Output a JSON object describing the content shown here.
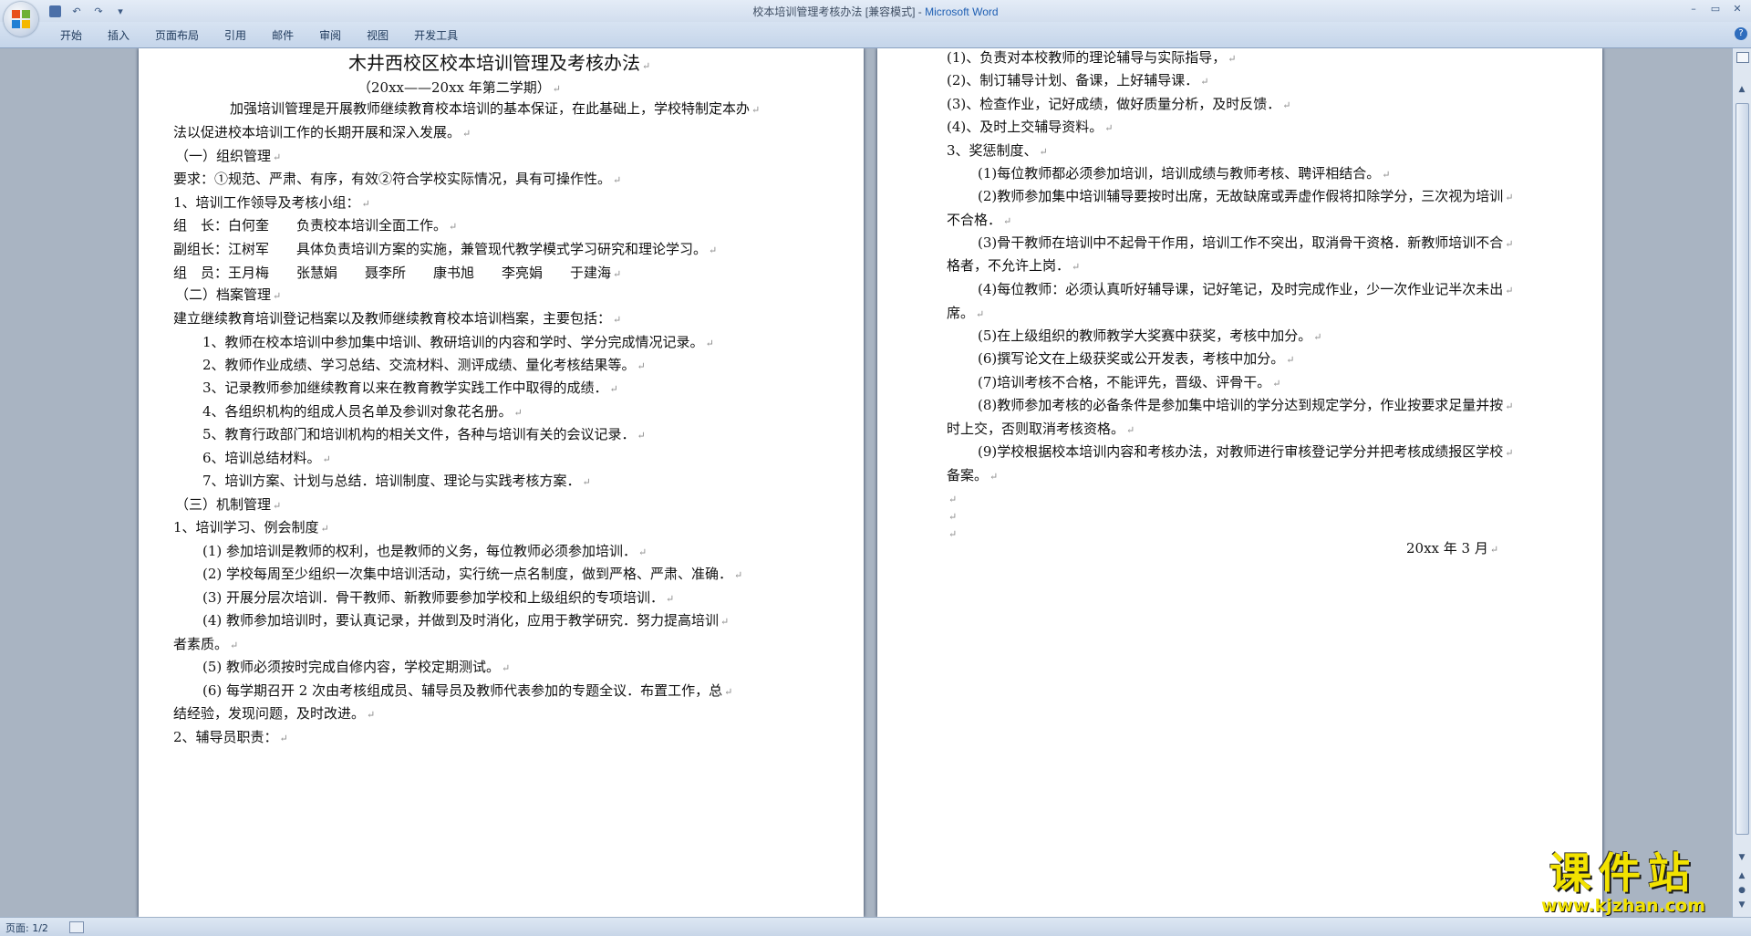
{
  "window": {
    "title": "校本培训管理考核办法 [兼容模式] - ",
    "app_name": "Microsoft Word",
    "controls": [
      "–",
      "▭",
      "✕"
    ]
  },
  "ribbon": {
    "tabs": [
      "开始",
      "插入",
      "页面布局",
      "引用",
      "邮件",
      "审阅",
      "视图",
      "开发工具"
    ],
    "help": "?"
  },
  "document": {
    "page1": [
      "木井西校区校本培训管理及考核办法",
      "（20xx——20xx 年第二学期）",
      "加强培训管理是开展教师继续教育校本培训的基本保证，在此基础上，学校特制定本办",
      "法以促进校本培训工作的长期开展和深入发展。",
      "（一）组织管理",
      "要求：①规范、严肃、有序，有效②符合学校实际情况，具有可操作性。",
      "1、培训工作领导及考核小组：",
      "组　长：白何奎　　负责校本培训全面工作。",
      "副组长：江树军　　具体负责培训方案的实施，兼管现代教学模式学习研究和理论学习。",
      "组　员：王月梅　　张慧娟　　聂李所　　康书旭　　李亮娟　　于建海",
      "（二）档案管理",
      "建立继续教育培训登记档案以及教师继续教育校本培训档案，主要包括：",
      "1、教师在校本培训中参加集中培训、教研培训的内容和学时、学分完成情况记录。",
      "2、教师作业成绩、学习总结、交流材料、测评成绩、量化考核结果等。",
      "3、记录教师参加继续教育以来在教育教学实践工作中取得的成绩．",
      "4、各组织机构的组成人员名单及参训对象花名册。",
      "5、教育行政部门和培训机构的相关文件，各种与培训有关的会议记录．",
      "6、培训总结材料。",
      "7、培训方案、计划与总结．培训制度、理论与实践考核方案．",
      "（三）机制管理",
      "1、培训学习、例会制度",
      "(1) 参加培训是教师的权利，也是教师的义务，每位教师必须参加培训．",
      "(2) 学校每周至少组织一次集中培训活动，实行统一点名制度，做到严格、严肃、准确．",
      "(3) 开展分层次培训．骨干教师、新教师要参加学校和上级组织的专项培训．",
      "(4) 教师参加培训时，要认真记录，并做到及时消化，应用于教学研究．努力提高培训",
      "者素质。",
      "(5) 教师必须按时完成自修内容，学校定期测试。",
      "(6) 每学期召开 2 次由考核组成员、辅导员及教师代表参加的专题全议．布置工作，总",
      "结经验，发现问题，及时改进。",
      "2、辅导员职责："
    ],
    "page2": [
      "(1)、负责对本校教师的理论辅导与实际指导，",
      "(2)、制订辅导计划、备课，上好辅导课．",
      "(3)、检查作业，记好成绩，做好质量分析，及时反馈．",
      "(4)、及时上交辅导资料。",
      "3、奖惩制度、",
      "(1)每位教师都必须参加培训，培训成绩与教师考核、聘评相结合。",
      "(2)教师参加集中培训辅导要按时出席，无故缺席或弄虚作假将扣除学分，三次视为培训",
      "不合格．",
      "(3)骨干教师在培训中不起骨干作用，培训工作不突出，取消骨干资格．新教师培训不合",
      "格者，不允许上岗．",
      "(4)每位教师：必须认真听好辅导课，记好笔记，及时完成作业，少一次作业记半次未出",
      "席。",
      "(5)在上级组织的教师教学大奖赛中获奖，考核中加分。",
      "(6)撰写论文在上级获奖或公开发表，考核中加分。",
      "(7)培训考核不合格，不能评先，晋级、评骨干。",
      "(8)教师参加考核的必备条件是参加集中培训的学分达到规定学分，作业按要求足量并按",
      "时上交，否则取消考核资格。",
      "(9)学校根据校本培训内容和考核办法，对教师进行审核登记学分并把考核成绩报区学校",
      "备案。",
      "",
      "",
      "",
      "20xx 年 3 月"
    ]
  },
  "status": {
    "page": "页面: 1/2"
  },
  "watermark": {
    "title": "课件站",
    "url": "www.kjzhan.com"
  },
  "colors": {
    "accent": "#1f5fb3",
    "workspace": "#a9b4c2",
    "watermark": "#f2e200"
  }
}
